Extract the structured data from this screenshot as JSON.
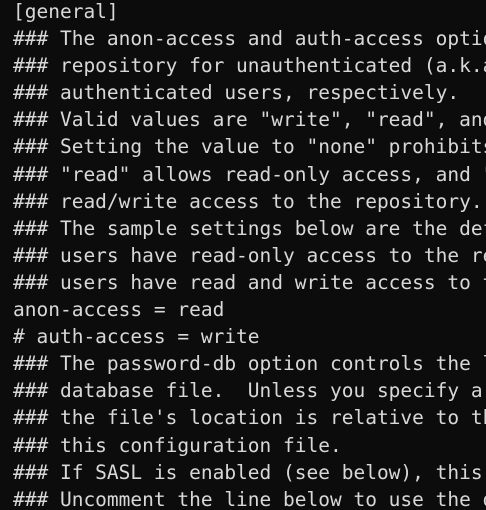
{
  "terminal": {
    "lines": [
      "[general]",
      "### The anon-access and auth-access options control access to the",
      "### repository for unauthenticated (a.k.a. anonymous) users and",
      "### authenticated users, respectively.",
      "### Valid values are \"write\", \"read\", and \"none\".",
      "### Setting the value to \"none\" prohibits both reading and writing;",
      "### \"read\" allows read-only access, and \"write\" allows complete",
      "### read/write access to the repository.",
      "### The sample settings below are the defaults and specify that anonymous",
      "### users have read-only access to the repository, while authenticated",
      "### users have read and write access to the repository.",
      "anon-access = read",
      "# auth-access = write",
      "### The password-db option controls the location of the password",
      "### database file.  Unless you specify a path starting with a /,",
      "### the file's location is relative to the directory containing",
      "### this configuration file.",
      "### If SASL is enabled (see below), this file will NOT be used.",
      "### Uncomment the line below to use the default password file."
    ]
  }
}
